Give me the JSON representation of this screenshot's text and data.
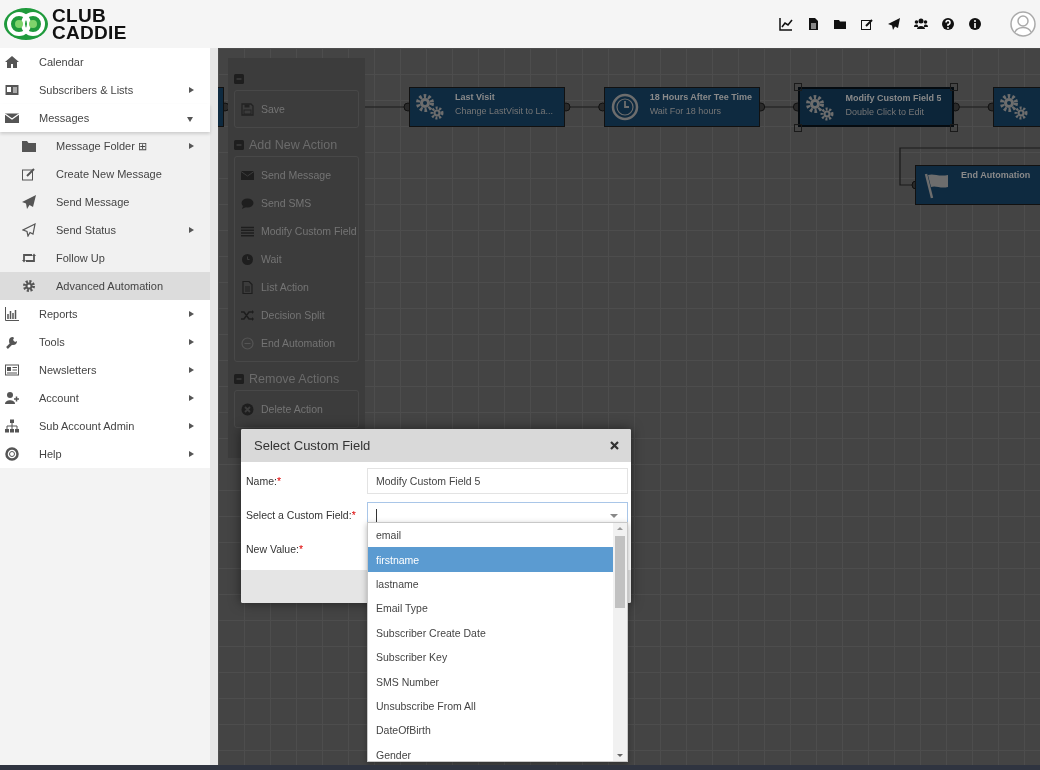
{
  "logo": {
    "lines": [
      "CLUB",
      "CADDIE"
    ]
  },
  "sidebar": {
    "items": [
      {
        "label": "Calendar",
        "submenu": false,
        "expanded": false,
        "selected": false
      },
      {
        "label": "Subscribers & Lists",
        "submenu": true,
        "expanded": false,
        "selected": false
      },
      {
        "label": "Messages",
        "submenu": true,
        "expanded": true,
        "selected": false,
        "children": [
          {
            "label": "Message Folder ⊞",
            "submenu": true,
            "selected": false
          },
          {
            "label": "Create New Message",
            "submenu": false,
            "selected": false
          },
          {
            "label": "Send Message",
            "submenu": false,
            "selected": false
          },
          {
            "label": "Send Status",
            "submenu": true,
            "selected": false
          },
          {
            "label": "Follow Up",
            "submenu": false,
            "selected": false
          },
          {
            "label": "Advanced Automation",
            "submenu": false,
            "selected": true
          }
        ]
      },
      {
        "label": "Reports",
        "submenu": true,
        "expanded": false,
        "selected": false
      },
      {
        "label": "Tools",
        "submenu": true,
        "expanded": false,
        "selected": false
      },
      {
        "label": "Newsletters",
        "submenu": true,
        "expanded": false,
        "selected": false
      },
      {
        "label": "Account",
        "submenu": true,
        "expanded": false,
        "selected": false
      },
      {
        "label": "Sub Account Admin",
        "submenu": true,
        "expanded": false,
        "selected": false
      },
      {
        "label": "Help",
        "submenu": true,
        "expanded": false,
        "selected": false
      }
    ]
  },
  "toolbox": {
    "sections": [
      {
        "items": [
          {
            "label": "Save"
          }
        ]
      },
      {
        "title": "Add New Action",
        "items": [
          {
            "label": "Send Message"
          },
          {
            "label": "Send SMS"
          },
          {
            "label": "Modify Custom Field"
          },
          {
            "label": "Wait"
          },
          {
            "label": "List Action"
          },
          {
            "label": "Decision Split"
          },
          {
            "label": "End Automation"
          }
        ]
      },
      {
        "title": "Remove Actions",
        "items": [
          {
            "label": "Delete Action"
          }
        ]
      }
    ]
  },
  "workflow": {
    "nodes": [
      {
        "selected": false
      },
      {
        "kind": "action",
        "title": "Last Visit",
        "subtitle": "Change LastVisit to La...",
        "selected": false
      },
      {
        "kind": "wait",
        "title": "18 Hours After Tee Time",
        "subtitle": "Wait For 18 hours",
        "selected": false
      },
      {
        "kind": "action",
        "title": "Modify Custom Field 5",
        "subtitle": "Double Click to Edit",
        "selected": true
      },
      {
        "kind": "action",
        "selected": false
      }
    ],
    "branch": [
      {
        "kind": "end",
        "title": "End Automation",
        "selected": false
      }
    ]
  },
  "dialog": {
    "title": "Select Custom Field",
    "fields": [
      {
        "kind": "text",
        "label": "Name:",
        "required_mark": "*",
        "value": "Modify Custom Field 5"
      },
      {
        "kind": "select",
        "label": "Select a Custom Field:",
        "required_mark": "*"
      },
      {
        "kind": "text",
        "label": "New Value:",
        "required_mark": "*"
      }
    ],
    "dropdown": {
      "options": [
        {
          "label": "email",
          "selected": false
        },
        {
          "label": "firstname",
          "selected": true
        },
        {
          "label": "lastname",
          "selected": false
        },
        {
          "label": "Email Type",
          "selected": false
        },
        {
          "label": "Subscriber Create Date",
          "selected": false
        },
        {
          "label": "Subscriber Key",
          "selected": false
        },
        {
          "label": "SMS Number",
          "selected": false
        },
        {
          "label": "Unsubscribe From All",
          "selected": false
        },
        {
          "label": "DateOfBirth",
          "selected": false
        },
        {
          "label": "Gender",
          "selected": false
        }
      ]
    }
  }
}
